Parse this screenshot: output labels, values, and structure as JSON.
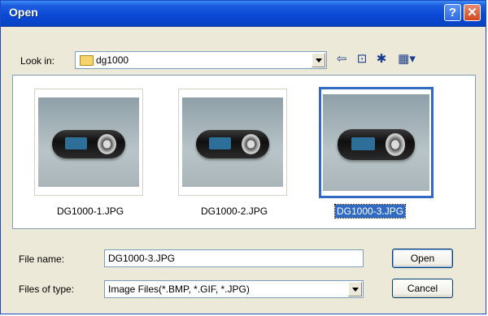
{
  "window": {
    "title": "Open"
  },
  "titlebar_buttons": {
    "help": "?",
    "close": "✕"
  },
  "look_in": {
    "label": "Look in:",
    "value": "dg1000"
  },
  "toolbar": [
    {
      "name": "back-icon",
      "glyph": "⇦"
    },
    {
      "name": "up-folder-icon",
      "glyph": "⊡"
    },
    {
      "name": "new-folder-icon",
      "glyph": "✱"
    },
    {
      "name": "views-menu-icon",
      "glyph": "▦▾"
    }
  ],
  "files": [
    {
      "name": "DG1000-1.JPG",
      "selected": false
    },
    {
      "name": "DG1000-2.JPG",
      "selected": false
    },
    {
      "name": "DG1000-3.JPG",
      "selected": true
    }
  ],
  "file_name": {
    "label": "File name:",
    "value": "DG1000-3.JPG"
  },
  "file_type": {
    "label": "Files of type:",
    "value": "Image Files(*.BMP, *.GIF, *.JPG)"
  },
  "buttons": {
    "open": "Open",
    "cancel": "Cancel"
  },
  "colors": {
    "titlebar": "#0a49d6",
    "selection": "#316ac5",
    "dialog_bg": "#ece9d8"
  }
}
